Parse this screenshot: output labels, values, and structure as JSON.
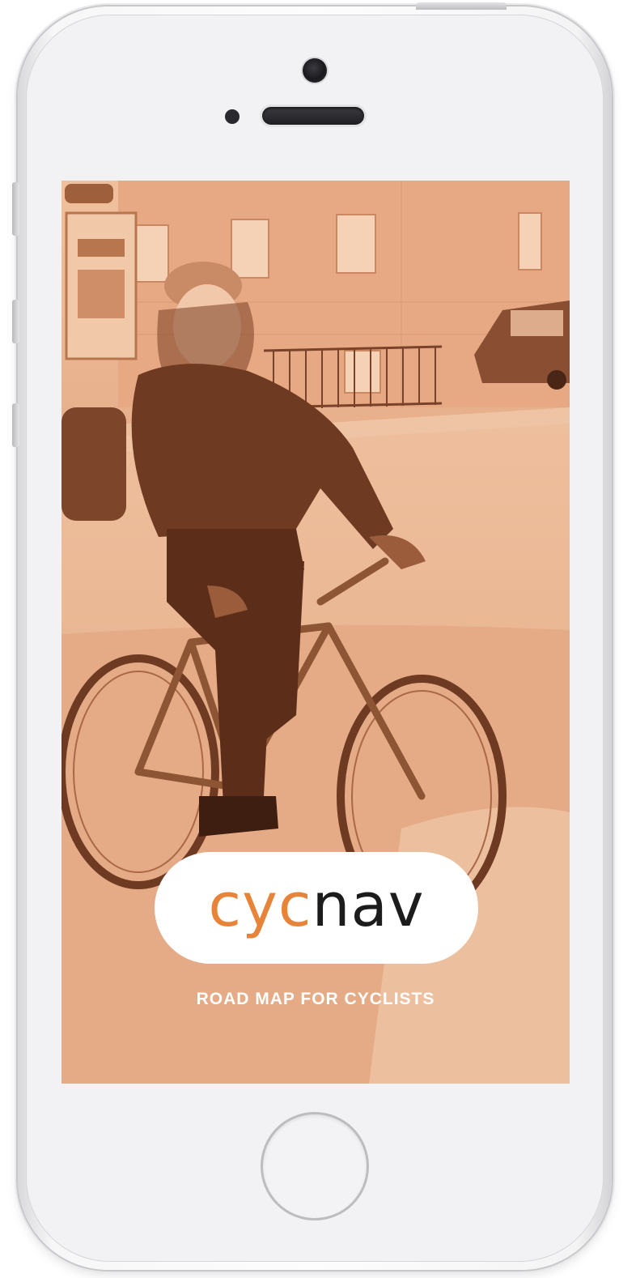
{
  "app": {
    "name_part1": "cyc",
    "name_part2": "nav",
    "tagline": "ROAD MAP FOR CYCLISTS"
  },
  "photo": {
    "subject": "person-riding-bicycle-icon",
    "tint_color": "#e9ad86"
  },
  "colors": {
    "brand_orange": "#e8843a",
    "brand_dark": "#1c1c1c",
    "logo_background": "#ffffff",
    "tagline_color": "#ffffff"
  }
}
